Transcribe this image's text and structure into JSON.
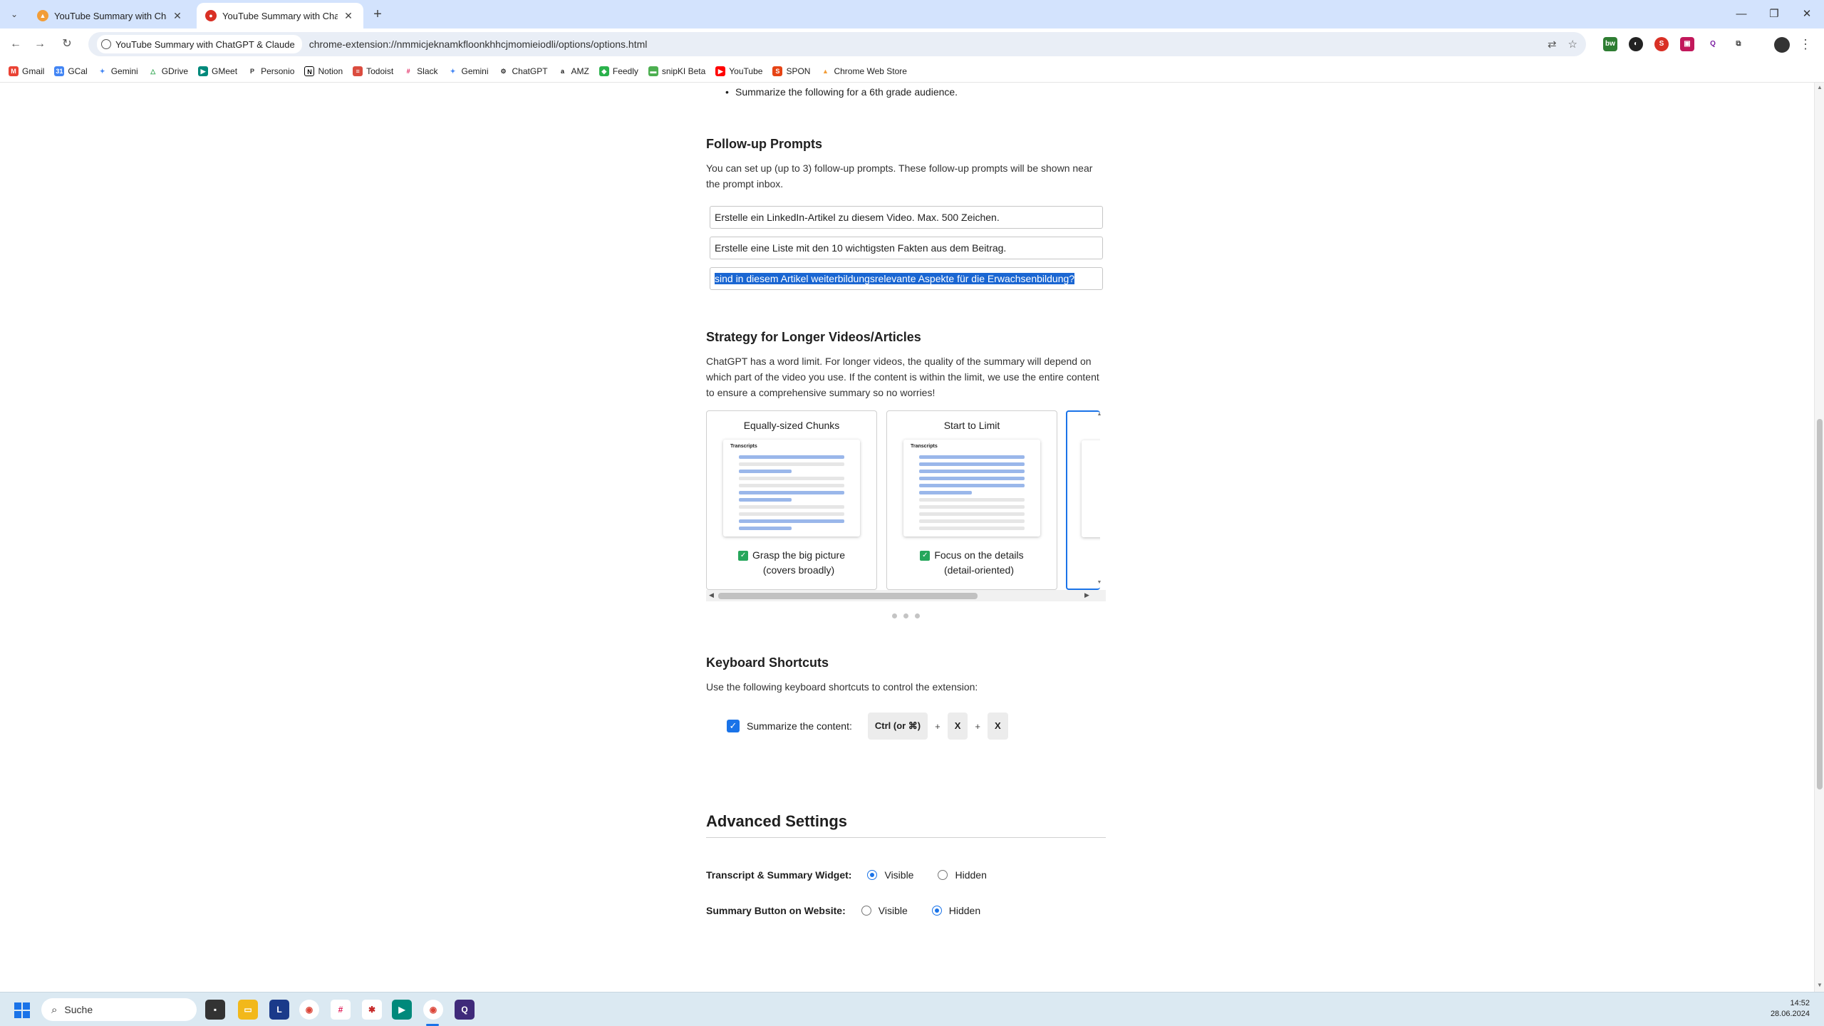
{
  "browser": {
    "tabs": [
      {
        "title": "YouTube Summary with ChatGPT & Claude",
        "active": false
      },
      {
        "title": "YouTube Summary with ChatGPT & Claude",
        "active": true
      }
    ],
    "site_chip": "YouTube Summary with ChatGPT & Claude",
    "url": "chrome-extension://nmmicjeknamkfloonkhhcjmomieiodli/options/options.html",
    "bookmarks": [
      "Gmail",
      "GCal",
      "Gemini",
      "GDrive",
      "GMeet",
      "Personio",
      "Notion",
      "Todoist",
      "Slack",
      "Gemini",
      "ChatGPT",
      "AMZ",
      "Feedly",
      "snipKI Beta",
      "YouTube",
      "SPON",
      "Chrome Web Store"
    ]
  },
  "page": {
    "bullet": "Summarize the following for a 6th grade audience.",
    "followup": {
      "title": "Follow-up Prompts",
      "desc": "You can set up (up to 3) follow-up prompts. These follow-up prompts will be shown near the prompt inbox.",
      "prompts": [
        "Erstelle ein LinkedIn-Artikel zu diesem Video. Max. 500 Zeichen.",
        "Erstelle eine Liste mit den 10 wichtigsten Fakten aus dem Beitrag.",
        "sind in diesem Artikel weiterbildungsrelevante Aspekte für die Erwachsenbildung?"
      ]
    },
    "strategy": {
      "title": "Strategy for Longer Videos/Articles",
      "desc": "ChatGPT has a word limit. For longer videos, the quality of the summary will depend on which part of the video you use. If the content is within the limit, we use the entire content to ensure a comprehensive summary so no worries!",
      "preview_label": "Transcripts",
      "cards": [
        {
          "title": "Equally-sized Chunks",
          "check_line1": "Grasp the big picture",
          "check_line2": "(covers broadly)"
        },
        {
          "title": "Start to Limit",
          "check_line1": "Focus on the details",
          "check_line2": "(detail-oriented)"
        }
      ]
    },
    "shortcuts": {
      "title": "Keyboard Shortcuts",
      "desc": "Use the following keyboard shortcuts to control the extension:",
      "label": "Summarize the content:",
      "keys": [
        "Ctrl (or ⌘)",
        "X",
        "X"
      ],
      "plus": "+"
    },
    "advanced": {
      "title": "Advanced Settings",
      "settings": [
        {
          "label": "Transcript & Summary Widget:",
          "options": [
            "Visible",
            "Hidden"
          ],
          "selected": "Visible"
        },
        {
          "label": "Summary Button on Website:",
          "options": [
            "Visible",
            "Hidden"
          ],
          "selected": "Hidden"
        }
      ]
    }
  },
  "taskbar": {
    "search_placeholder": "Suche",
    "time": "14:52",
    "date": "28.06.2024"
  },
  "colors": {
    "tabbar": "#d3e3fd",
    "accent": "#1a73e8",
    "check_green": "#26a65b",
    "taskbar": "#dbe9f2"
  }
}
